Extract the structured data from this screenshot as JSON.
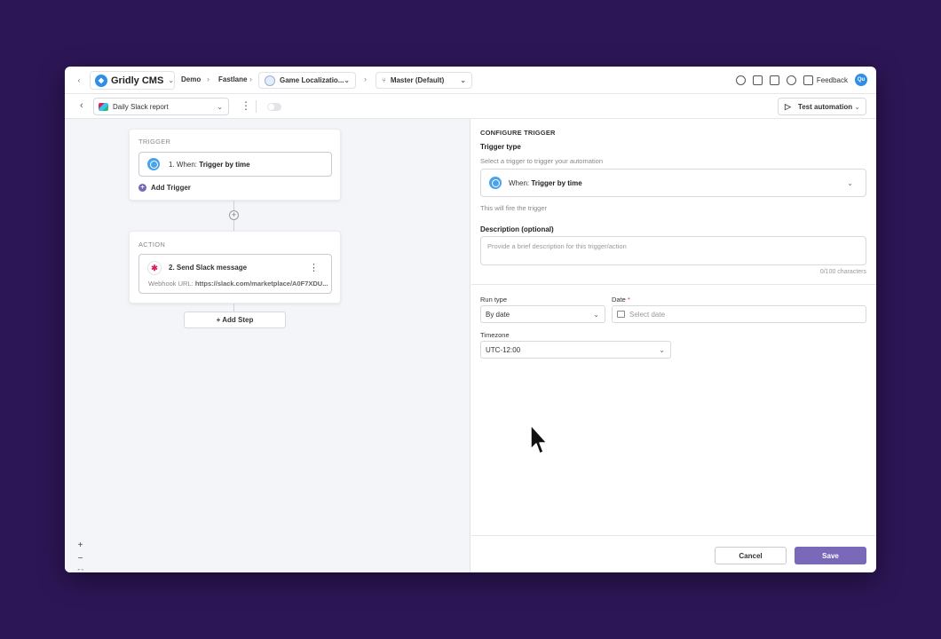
{
  "topnav": {
    "app_name": "Gridly CMS",
    "breadcrumbs": [
      "Demo",
      "Fastlane"
    ],
    "project": "Game Localizatio...",
    "branch": "Master (Default)",
    "feedback": "Feedback",
    "avatar_initials": "Qu"
  },
  "toolbar": {
    "automation_name": "Daily Slack report",
    "test_button": "Test automation"
  },
  "canvas": {
    "trigger_label": "TRIGGER",
    "trigger_prefix": "1. When:",
    "trigger_value": "Trigger by time",
    "add_trigger": "Add Trigger",
    "action_label": "ACTION",
    "action_title": "2. Send Slack message",
    "webhook_prefix": "Webhook URL:",
    "webhook_value": "https://slack.com/marketplace/A0F7XDU...",
    "add_step": "+ Add Step",
    "zoom_in": "+",
    "zoom_out": "−",
    "fit": "⛶"
  },
  "panel": {
    "title": "CONFIGURE TRIGGER",
    "trigger_type_label": "Trigger type",
    "trigger_type_hint": "Select a trigger to trigger your automation",
    "trigger_prefix": "When:",
    "trigger_value": "Trigger by time",
    "fire_note": "This will fire the trigger",
    "description_label": "Description (optional)",
    "description_placeholder": "Provide a brief description for this trigger/action",
    "char_counter": "0/100 characters",
    "run_type_label": "Run type",
    "run_type_value": "By date",
    "date_label": "Date",
    "date_required": "*",
    "date_placeholder": "Select date",
    "timezone_label": "Timezone",
    "timezone_value": "UTC-12:00",
    "cancel": "Cancel",
    "save": "Save"
  },
  "colors": {
    "accent": "#7a68b8",
    "background": "#2d1656",
    "trigger_icon": "#4aa3ea"
  }
}
